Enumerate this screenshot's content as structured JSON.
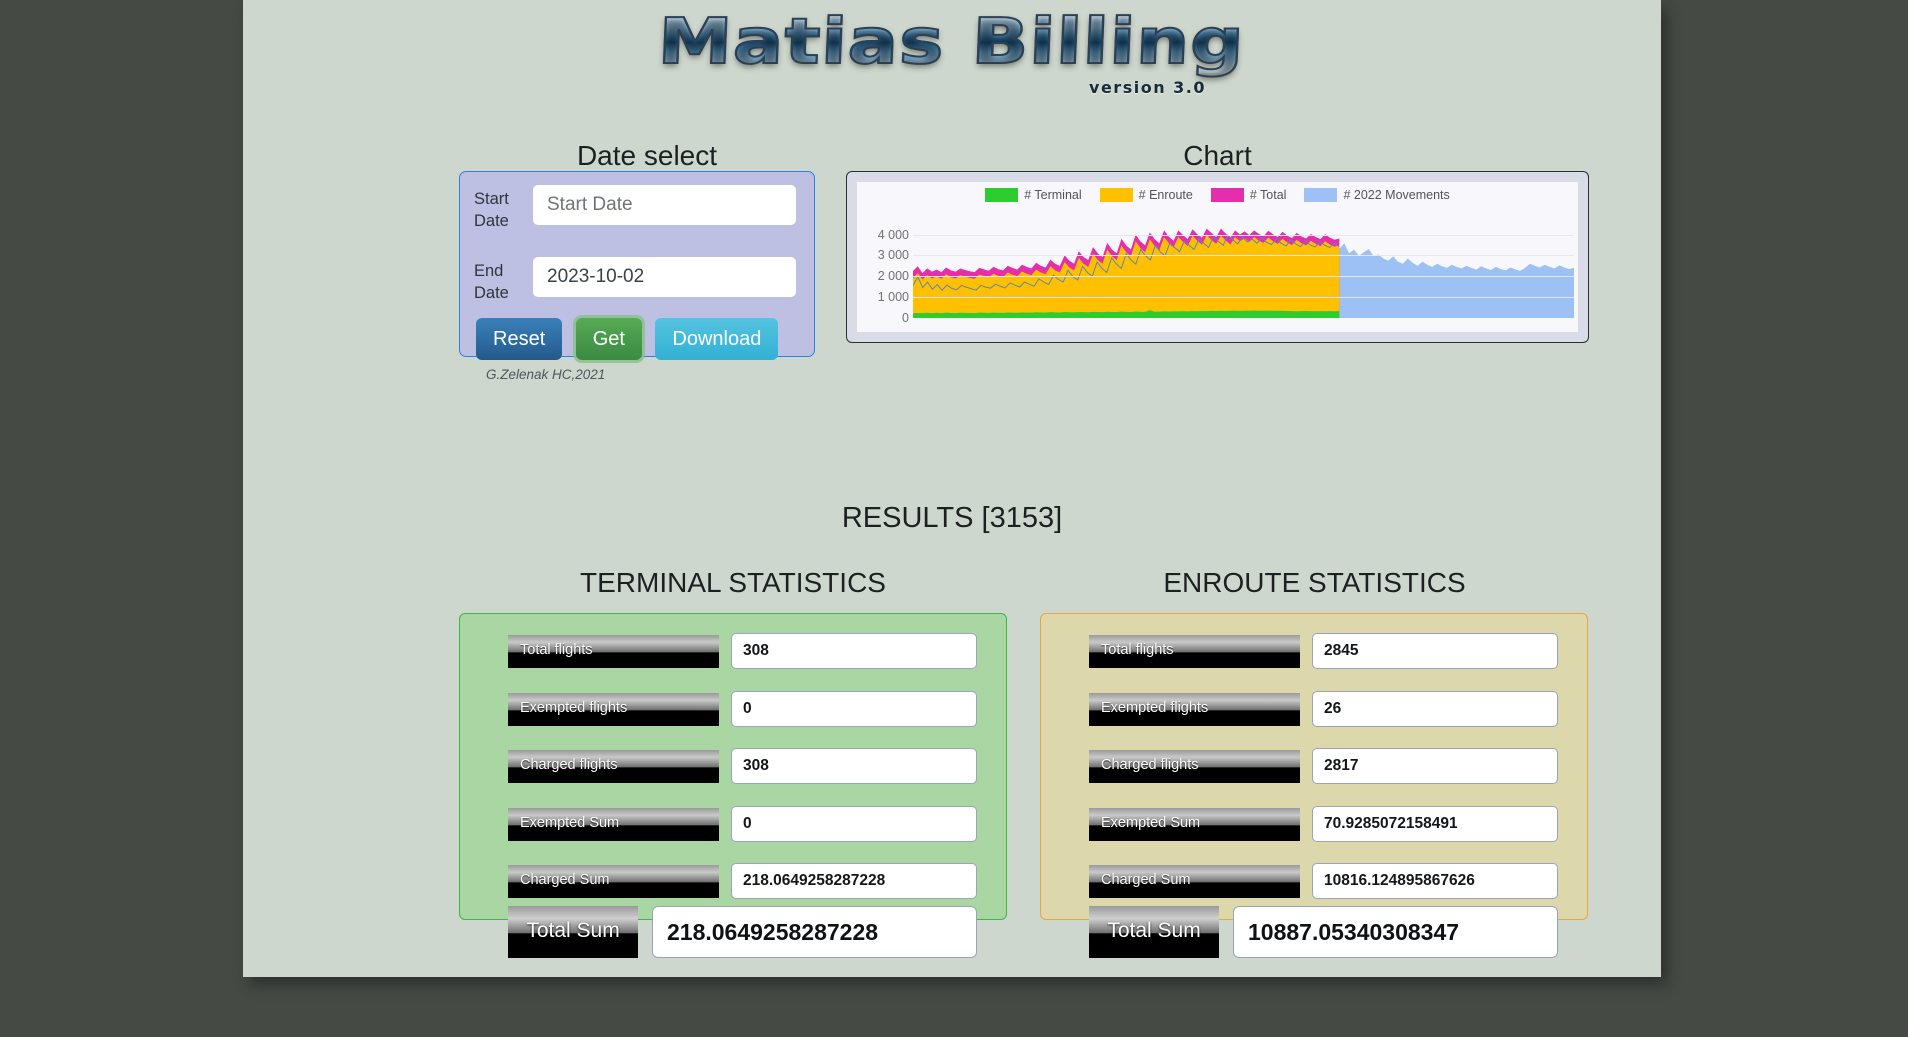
{
  "app": {
    "logo_text": "Matias Billing",
    "version": "version 3.0",
    "credit": "G.Zelenak HC,2021"
  },
  "sections": {
    "date_title": "Date select",
    "chart_title": "Chart",
    "results_title": "RESULTS [3153]",
    "terminal_title": "TERMINAL STATISTICS",
    "enroute_title": "ENROUTE STATISTICS"
  },
  "date_select": {
    "start_label": "Start Date",
    "start_placeholder": "Start Date",
    "start_value": "",
    "end_label": "End Date",
    "end_placeholder": "End Date",
    "end_value": "2023-10-02",
    "buttons": {
      "reset": "Reset",
      "get": "Get",
      "download": "Download"
    }
  },
  "chart_data": {
    "type": "area",
    "title": "Chart",
    "xlabel": "",
    "ylabel": "",
    "ylim": [
      0,
      4600
    ],
    "grid": true,
    "legend_position": "top-center",
    "yticks": [
      "0",
      "1 000",
      "2 000",
      "3 000",
      "4 000"
    ],
    "ytick_values": [
      0,
      1000,
      2000,
      3000,
      4000
    ],
    "colors": {
      "terminal": "#2ecc2e",
      "enroute": "#ffc000",
      "total": "#e62dab",
      "movements_2022": "#9dc0f5",
      "movements_line": "#5f86b5"
    },
    "series": [
      {
        "name": "# Terminal",
        "color": "#2ecc2e",
        "values": [
          230,
          240,
          225,
          250,
          235,
          245,
          230,
          255,
          240,
          235,
          250,
          245,
          240,
          235,
          255,
          250,
          245,
          260,
          250,
          245,
          265,
          255,
          250,
          270,
          260,
          255,
          275,
          265,
          260,
          280,
          270,
          265,
          285,
          275,
          270,
          290,
          280,
          275,
          295,
          285,
          280,
          300,
          290,
          285,
          305,
          295,
          290,
          310,
          300,
          295,
          380,
          300,
          305,
          315,
          310,
          320,
          315,
          325,
          320,
          330,
          325,
          335,
          330,
          340,
          335,
          345,
          340,
          350,
          345,
          340,
          350,
          345,
          355,
          350,
          345,
          355,
          350,
          345,
          340,
          335,
          330,
          325,
          330,
          335,
          330,
          325,
          330,
          325,
          330,
          325,
          330
        ]
      },
      {
        "name": "# Enroute",
        "color": "#ffc000",
        "values": [
          1900,
          2150,
          1850,
          2050,
          1900,
          2000,
          1880,
          2100,
          1950,
          1900,
          2050,
          1980,
          1920,
          1880,
          2080,
          2010,
          1950,
          2120,
          2020,
          1960,
          2180,
          2080,
          2000,
          2220,
          2120,
          2050,
          2320,
          2180,
          2100,
          2480,
          2280,
          2180,
          2680,
          2420,
          2280,
          2880,
          2600,
          2450,
          3080,
          2780,
          2600,
          3280,
          2950,
          2780,
          3480,
          3150,
          2950,
          3680,
          3350,
          3150,
          3780,
          3450,
          3250,
          3880,
          3580,
          3380,
          3880,
          3650,
          3450,
          3950,
          3700,
          3520,
          3980,
          3750,
          3550,
          3950,
          3720,
          3520,
          3880,
          3680,
          3820,
          3650,
          3880,
          3700,
          3600,
          3850,
          3680,
          3550,
          3800,
          3620,
          3500,
          3750,
          3580,
          3480,
          3700,
          3550,
          3450,
          3680,
          3520,
          3420,
          3480
        ]
      },
      {
        "name": "# Total",
        "color": "#e62dab",
        "values": [
          2250,
          2480,
          2150,
          2380,
          2220,
          2320,
          2200,
          2420,
          2280,
          2220,
          2370,
          2300,
          2240,
          2200,
          2400,
          2330,
          2270,
          2450,
          2340,
          2280,
          2500,
          2400,
          2320,
          2550,
          2450,
          2370,
          2650,
          2500,
          2420,
          2800,
          2600,
          2500,
          3000,
          2750,
          2600,
          3200,
          2920,
          2780,
          3400,
          3100,
          2920,
          3600,
          3280,
          3100,
          3800,
          3480,
          3280,
          4000,
          3680,
          3480,
          4100,
          3780,
          3580,
          4200,
          3900,
          3700,
          4200,
          3980,
          3780,
          4250,
          4020,
          3850,
          4280,
          4080,
          3880,
          4280,
          4050,
          3850,
          4200,
          4000,
          4150,
          3980,
          4200,
          4030,
          3930,
          4180,
          4010,
          3880,
          4130,
          3950,
          3830,
          4080,
          3910,
          3810,
          4030,
          3880,
          3780,
          4010,
          3850,
          3750,
          3810
        ]
      },
      {
        "name": "# 2022 Movements",
        "color": "#9dc0f5",
        "values": [
          1550,
          1980,
          1450,
          1720,
          1380,
          1600,
          1330,
          1580,
          1420,
          1350,
          1560,
          1480,
          1400,
          1330,
          1560,
          1480,
          1430,
          1620,
          1520,
          1440,
          1680,
          1580,
          1480,
          1720,
          1620,
          1520,
          1880,
          1720,
          1600,
          2050,
          1850,
          1720,
          2280,
          1980,
          1820,
          2480,
          2180,
          2000,
          2680,
          2380,
          2180,
          2880,
          2580,
          2380,
          3080,
          2780,
          2580,
          3280,
          2980,
          2780,
          3480,
          3180,
          2980,
          3580,
          3380,
          3180,
          3680,
          3480,
          3280,
          3780,
          3580,
          3380,
          3880,
          3680,
          3480,
          3980,
          3750,
          3550,
          3880,
          3650,
          3780,
          3580,
          3850,
          3620,
          3520,
          3800,
          3580,
          3450,
          3750,
          3550,
          3420,
          3700,
          3500,
          3400,
          3650,
          3480,
          3380,
          3580,
          3420,
          3320,
          3580,
          3100,
          3280,
          2980,
          3150,
          3300,
          2980,
          3050,
          2850,
          2750,
          2950,
          2700,
          2600,
          2850,
          2650,
          2500,
          2700,
          2550,
          2450,
          2600,
          2480,
          2400,
          2550,
          2450,
          2380,
          2500,
          2400,
          2320,
          2480,
          2380,
          2300,
          2450,
          2350,
          2280,
          2420,
          2330,
          2260,
          2400,
          2600,
          2500,
          2420,
          2550,
          2450,
          2380,
          2520,
          2420,
          2350,
          2400
        ]
      }
    ],
    "legend": [
      {
        "label": "# Terminal",
        "color": "#2ecc2e"
      },
      {
        "label": "# Enroute",
        "color": "#ffc000"
      },
      {
        "label": "# Total",
        "color": "#e62dab"
      },
      {
        "label": "# 2022 Movements",
        "color": "#9dc0f5"
      }
    ]
  },
  "terminal_stats": {
    "rows": [
      {
        "label": "Total flights",
        "value": "308"
      },
      {
        "label": "Exempted flights",
        "value": "0"
      },
      {
        "label": "Charged flights",
        "value": "308"
      },
      {
        "label": "Exempted Sum",
        "value": "0"
      },
      {
        "label": "Charged Sum",
        "value": "218.0649258287228"
      }
    ],
    "total_label": "Total Sum",
    "total_value": "218.0649258287228"
  },
  "enroute_stats": {
    "rows": [
      {
        "label": "Total flights",
        "value": "2845"
      },
      {
        "label": "Exempted flights",
        "value": "26"
      },
      {
        "label": "Charged flights",
        "value": "2817"
      },
      {
        "label": "Exempted Sum",
        "value": "70.9285072158491"
      },
      {
        "label": "Charged Sum",
        "value": "10816.124895867626"
      }
    ],
    "total_label": "Total Sum",
    "total_value": "10887.05340308347"
  }
}
